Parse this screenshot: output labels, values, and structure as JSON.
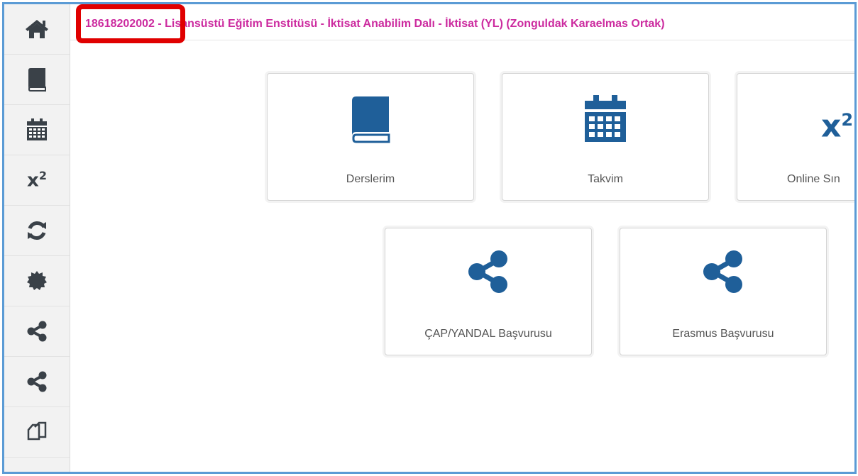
{
  "topbar": {
    "title": "18618202002 - Lisansüstü Eğitim Enstitüsü - İktisat Anabilim Dalı - İktisat (YL) (Zonguldak Karaelmas Ortak)"
  },
  "sidebar": {
    "items": [
      {
        "icon": "home-icon"
      },
      {
        "icon": "book-icon"
      },
      {
        "icon": "calendar-icon"
      },
      {
        "icon": "superscript-icon",
        "text": "x",
        "sup": "2"
      },
      {
        "icon": "refresh-icon"
      },
      {
        "icon": "certificate-icon"
      },
      {
        "icon": "share-icon"
      },
      {
        "icon": "share-icon"
      },
      {
        "icon": "copy-icon"
      }
    ]
  },
  "cards": [
    {
      "label": "Derslerim",
      "icon": "book-icon"
    },
    {
      "label": "Takvim",
      "icon": "calendar-icon"
    },
    {
      "label": "Online Sın",
      "icon": "superscript-icon",
      "icon_text": "x",
      "icon_sup": "2"
    },
    {
      "label": "ÇAP/YANDAL Başvurusu",
      "icon": "share-icon"
    },
    {
      "label": "Erasmus Başvurusu",
      "icon": "share-icon"
    }
  ],
  "colors": {
    "title": "#cc2b9f",
    "card_icon": "#1f5f99",
    "sidebar_icon": "#3a4148",
    "frame_border": "#5b9bd5",
    "highlight_box": "#e00000"
  }
}
